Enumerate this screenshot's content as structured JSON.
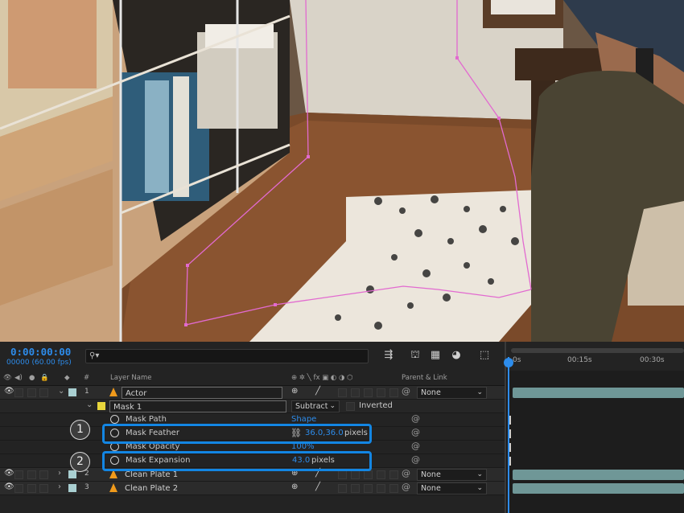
{
  "timeline": {
    "timecode": "0:00:00:00",
    "fps_label": "00000 (60.00 fps)",
    "search_icon": "search-icon"
  },
  "columns": {
    "number": "#",
    "layer_name": "Layer Name",
    "parent_link": "Parent & Link"
  },
  "layers": [
    {
      "number": "1",
      "name": "Actor",
      "parent": "None",
      "swatch_color": "#a9cfd1"
    },
    {
      "number": "2",
      "name": "Clean Plate 1",
      "parent": "None",
      "swatch_color": "#a9cfd1"
    },
    {
      "number": "3",
      "name": "Clean Plate 2",
      "parent": "None",
      "swatch_color": "#a9cfd1"
    }
  ],
  "mask": {
    "name": "Mask 1",
    "swatch_color": "#e8d63c",
    "mode": "Subtract",
    "inverted_label": "Inverted"
  },
  "mask_props": {
    "path_label": "Mask Path",
    "path_value": "Shape",
    "feather_label": "Mask Feather",
    "feather_value": "36.0,36.0",
    "feather_unit": "pixels",
    "opacity_label": "Mask Opacity",
    "opacity_value": "100%",
    "expansion_label": "Mask Expansion",
    "expansion_value": "43.0",
    "expansion_unit": "pixels"
  },
  "callouts": [
    "1",
    "2"
  ],
  "ruler": {
    "ticks": [
      "0s",
      "00:15s",
      "00:30s"
    ]
  },
  "colors": {
    "accent": "#2d8ceb",
    "highlight": "#1386e3",
    "track": "#6f9797",
    "mask_path": "#e26ad0"
  }
}
